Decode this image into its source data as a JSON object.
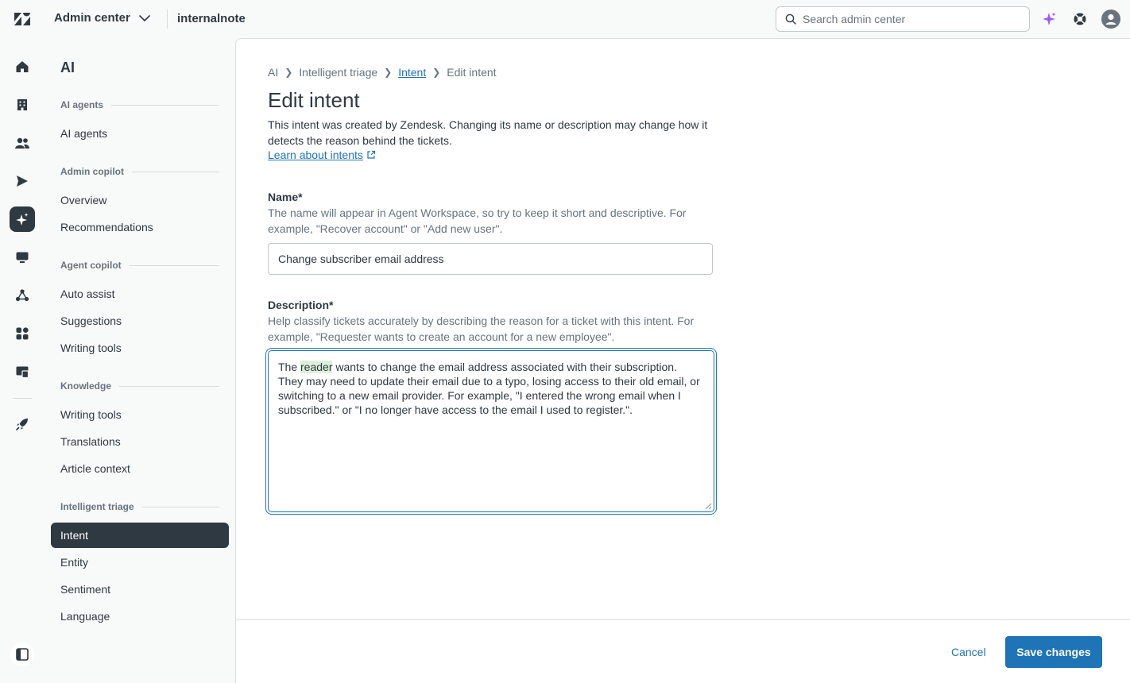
{
  "header": {
    "product_label": "Admin center",
    "subdomain": "internalnote",
    "search_placeholder": "Search admin center"
  },
  "sidebar": {
    "title": "AI",
    "groups": [
      {
        "label": "AI agents",
        "items": [
          "AI agents"
        ]
      },
      {
        "label": "Admin copilot",
        "items": [
          "Overview",
          "Recommendations"
        ]
      },
      {
        "label": "Agent copilot",
        "items": [
          "Auto assist",
          "Suggestions",
          "Writing tools"
        ]
      },
      {
        "label": "Knowledge",
        "items": [
          "Writing tools",
          "Translations",
          "Article context"
        ]
      },
      {
        "label": "Intelligent triage",
        "items": [
          "Intent",
          "Entity",
          "Sentiment",
          "Language"
        ]
      }
    ],
    "active_item": "Intent"
  },
  "breadcrumb": {
    "items": [
      "AI",
      "Intelligent triage",
      "Intent",
      "Edit intent"
    ]
  },
  "page": {
    "title": "Edit intent",
    "intro": "This intent was created by Zendesk. Changing its name or description may change how it detects the reason behind the tickets.",
    "learn_link": "Learn about intents"
  },
  "form": {
    "name_label": "Name*",
    "name_hint": "The name will appear in Agent Workspace, so try to keep it short and descriptive. For example, \"Recover account\" or \"Add new user\".",
    "name_value": "Change subscriber email address",
    "description_label": "Description*",
    "description_hint": "Help classify tickets accurately by describing the reason for a ticket with this intent. For example, \"Requester wants to create an account for a new employee\".",
    "description_prefix": "The ",
    "description_highlight": "reader",
    "description_rest": " wants to change the email address associated with their subscription. They may need to update their email due to a typo, losing access to their old email, or switching to a new email provider. For example, \"I entered the wrong email when I subscribed.\" or \"I no longer have access to the email I used to register.\"."
  },
  "footer": {
    "cancel_label": "Cancel",
    "save_label": "Save changes"
  },
  "colors": {
    "accent": "#1f73b7",
    "dark": "#2f3941",
    "highlight": "#dcf0d9",
    "sparkle": "#a259ff"
  },
  "icons": {
    "rail": [
      "home-icon",
      "building-icon",
      "people-icon",
      "send-icon",
      "sparkle-icon",
      "chat-icon",
      "objects-icon",
      "apps-icon",
      "workspace-icon",
      "rocket-icon",
      "sidebar-toggle-icon"
    ]
  }
}
